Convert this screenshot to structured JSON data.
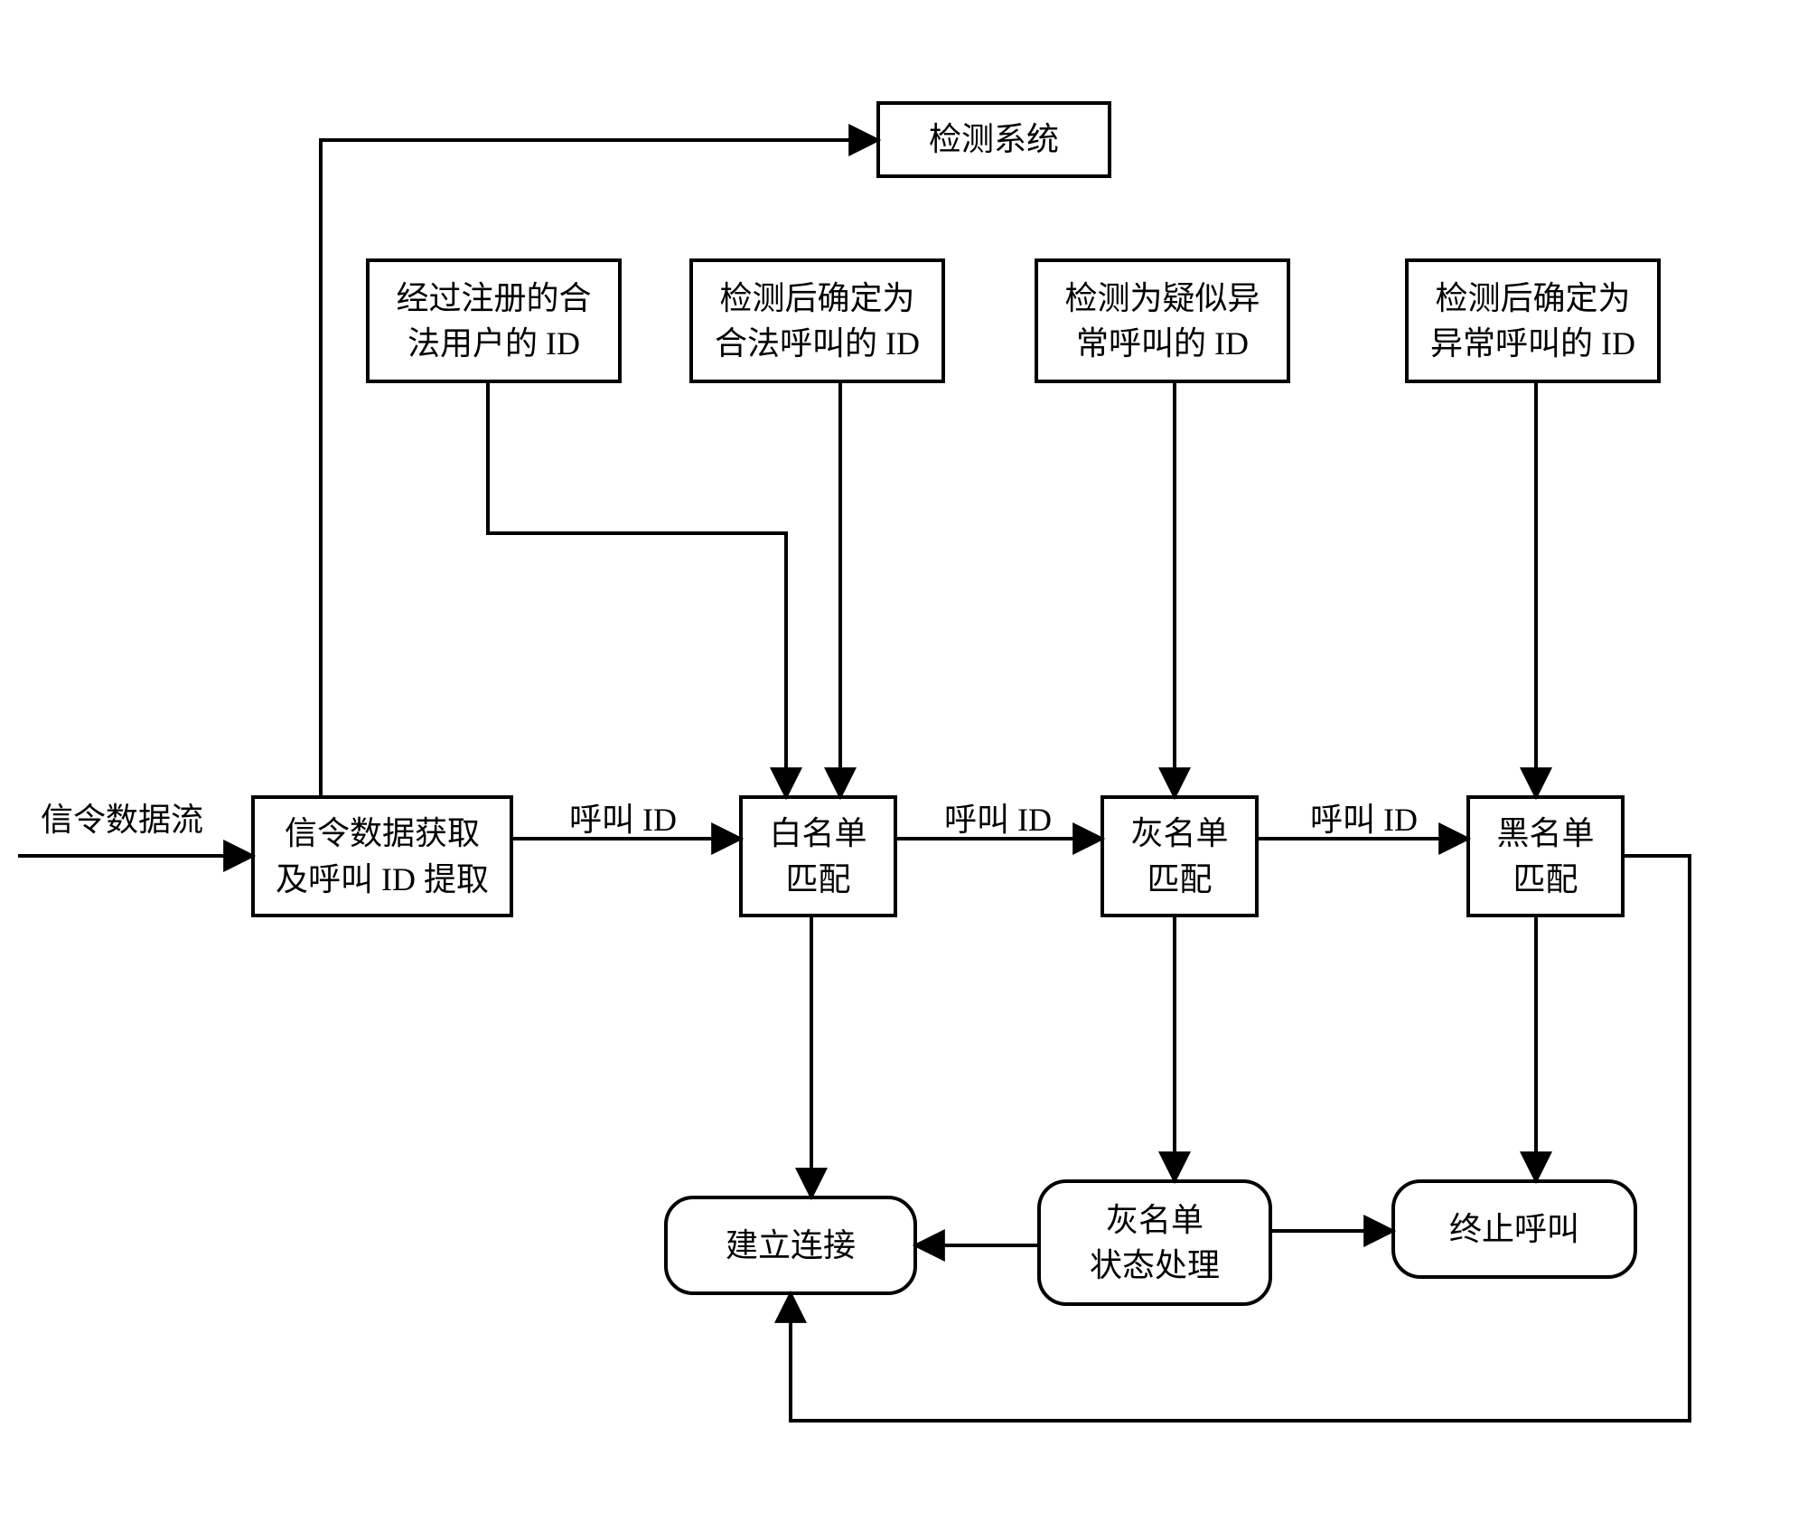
{
  "boxes": {
    "detection_system": "检测系统",
    "registered_legal_user_id_l1": "经过注册的合",
    "registered_legal_user_id_l2": "法用户的 ID",
    "confirmed_legal_call_id_l1": "检测后确定为",
    "confirmed_legal_call_id_l2": "合法呼叫的 ID",
    "suspected_abnormal_call_id_l1": "检测为疑似异",
    "suspected_abnormal_call_id_l2": "常呼叫的 ID",
    "confirmed_abnormal_call_id_l1": "检测后确定为",
    "confirmed_abnormal_call_id_l2": "异常呼叫的 ID",
    "signaling_acquire_l1": "信令数据获取",
    "signaling_acquire_l2": "及呼叫 ID 提取",
    "whitelist_match_l1": "白名单",
    "whitelist_match_l2": "匹配",
    "graylist_match_l1": "灰名单",
    "graylist_match_l2": "匹配",
    "blacklist_match_l1": "黑名单",
    "blacklist_match_l2": "匹配",
    "establish_connection": "建立连接",
    "graylist_state_process_l1": "灰名单",
    "graylist_state_process_l2": "状态处理",
    "terminate_call": "终止呼叫"
  },
  "labels": {
    "signaling_data_flow": "信令数据流",
    "call_id_1": "呼叫 ID",
    "call_id_2": "呼叫 ID",
    "call_id_3": "呼叫 ID"
  }
}
